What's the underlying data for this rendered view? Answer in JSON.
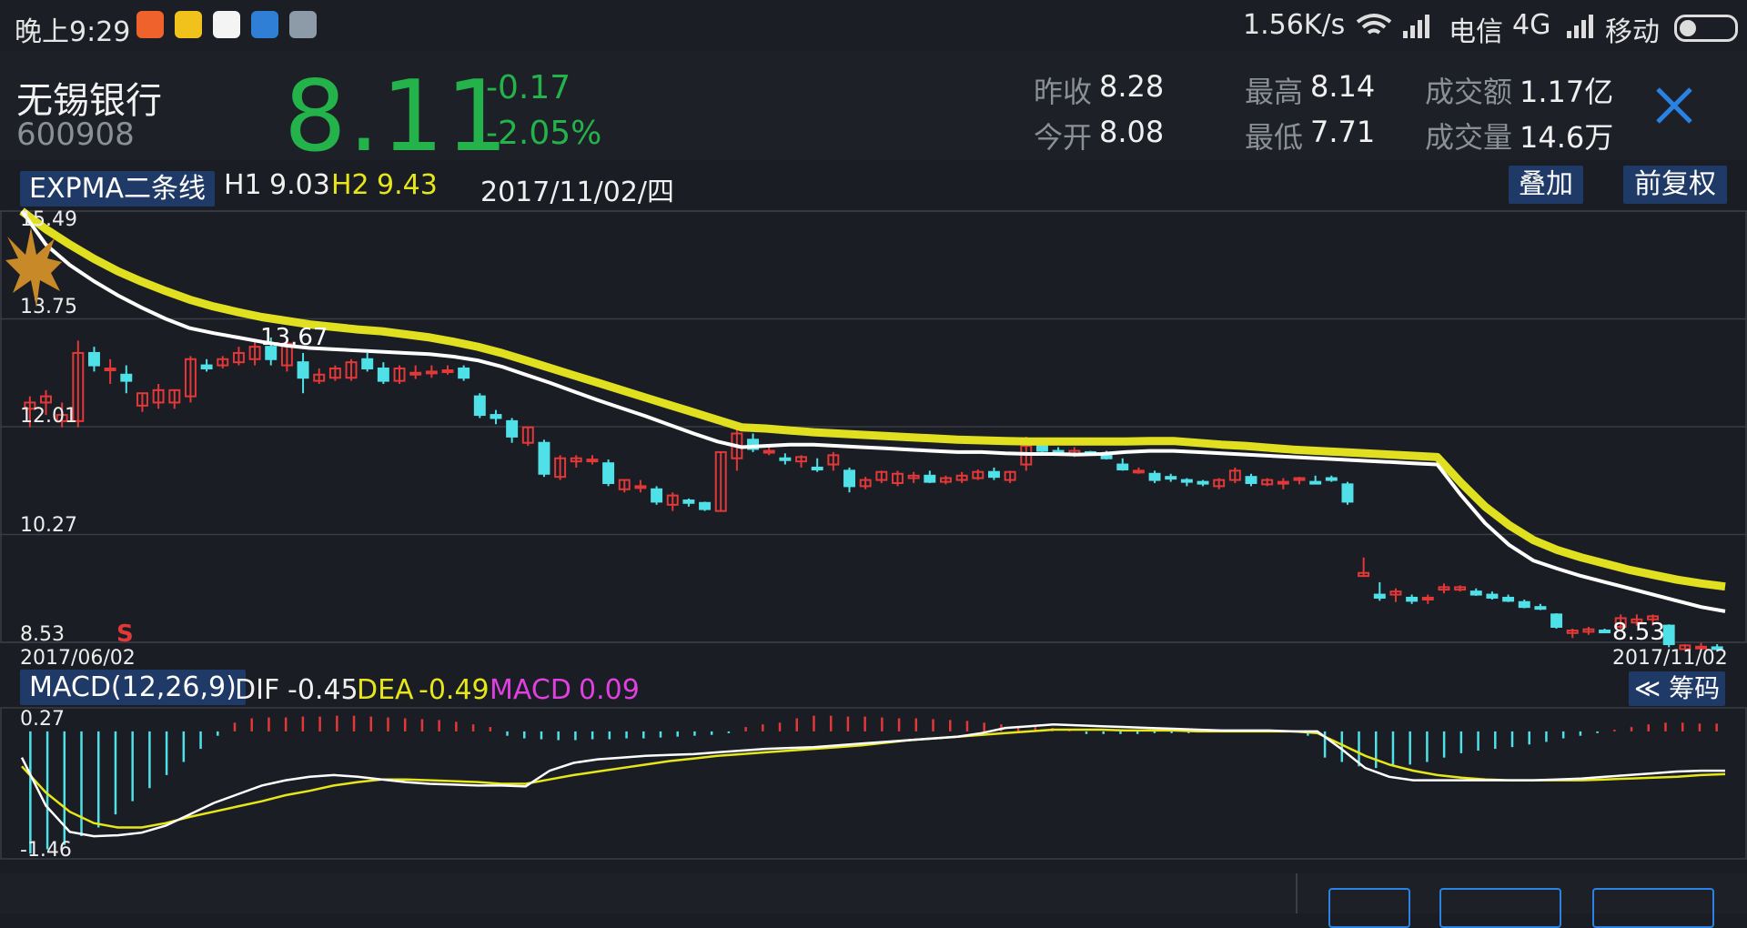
{
  "status_bar": {
    "time": "晚上9:29",
    "speed": "1.56K/s",
    "carrier1": "电信",
    "network": "4G",
    "carrier2": "移动"
  },
  "stock": {
    "name": "无锡银行",
    "code": "600908",
    "price": "8.11",
    "change": "-0.17",
    "change_pct": "-2.05%"
  },
  "stats": {
    "prev_close_label": "昨收",
    "prev_close": "8.28",
    "open_label": "今开",
    "open": "8.08",
    "high_label": "最高",
    "high": "8.14",
    "low_label": "最低",
    "low": "7.71",
    "turnover_label": "成交额",
    "turnover": "1.17亿",
    "volume_label": "成交量",
    "volume": "14.6万"
  },
  "main_chart": {
    "indicator": "EXPMA二条线",
    "h1_label": "H1",
    "h1": "9.03",
    "h2_label": "H2",
    "h2": "9.43",
    "date": "2017/11/02/四",
    "overlay_button": "叠加",
    "adjust_button": "前复权",
    "y_ticks": [
      "15.49",
      "13.75",
      "12.01",
      "10.27",
      "8.53"
    ],
    "start_date": "2017/06/02",
    "end_date": "2017/11/02",
    "high_mark": "13.67",
    "low_mark": "8.53",
    "signal": "S"
  },
  "macd": {
    "title": "MACD(12,26,9)",
    "dif_label": "DIF",
    "dif": "-0.45",
    "dea_label": "DEA",
    "dea": "-0.49",
    "macd_label": "MACD",
    "macd": "0.09",
    "chip_button": "≪ 筹码",
    "y_top": "0.27",
    "y_bottom": "-1.46"
  },
  "colors": {
    "up": "#e23838",
    "down": "#4fe0e8",
    "dif_line": "#ffffff",
    "dea_line": "#e6e61a",
    "expma_slow": "#e0e020",
    "price_green": "#24b24b",
    "button_bg": "#1f3a66"
  },
  "chart_data": [
    {
      "type": "candlestick",
      "title": "EXPMA二条线",
      "x_range": [
        "2017/06/02",
        "2017/11/02"
      ],
      "ylim": [
        8.53,
        15.49
      ],
      "y_ticks": [
        15.49,
        13.75,
        12.01,
        10.27,
        8.53
      ],
      "ohlc": [
        [
          12.3,
          12.5,
          12.0,
          12.4
        ],
        [
          12.4,
          12.6,
          12.2,
          12.5
        ],
        [
          12.1,
          12.4,
          12.0,
          12.2
        ],
        [
          12.1,
          13.4,
          12.0,
          13.2
        ],
        [
          13.2,
          13.3,
          12.9,
          13.0
        ],
        [
          12.95,
          13.1,
          12.7,
          12.95
        ],
        [
          12.85,
          13.0,
          12.55,
          12.75
        ],
        [
          12.35,
          12.55,
          12.25,
          12.55
        ],
        [
          12.4,
          12.7,
          12.3,
          12.6
        ],
        [
          12.4,
          12.6,
          12.3,
          12.6
        ],
        [
          12.5,
          13.15,
          12.4,
          13.1
        ],
        [
          13.0,
          13.1,
          12.9,
          12.95
        ],
        [
          13.0,
          13.15,
          12.95,
          13.1
        ],
        [
          13.05,
          13.3,
          13.0,
          13.2
        ],
        [
          13.1,
          13.4,
          13.0,
          13.3
        ],
        [
          13.3,
          13.45,
          13.0,
          13.1
        ],
        [
          13.0,
          13.4,
          12.9,
          13.35
        ],
        [
          13.05,
          13.2,
          12.55,
          12.8
        ],
        [
          12.75,
          12.95,
          12.7,
          12.85
        ],
        [
          12.8,
          13.0,
          12.75,
          12.95
        ],
        [
          12.8,
          13.1,
          12.75,
          13.05
        ],
        [
          13.1,
          13.2,
          12.9,
          12.95
        ],
        [
          12.95,
          13.05,
          12.7,
          12.75
        ],
        [
          12.75,
          13.0,
          12.7,
          12.95
        ],
        [
          12.88,
          13.0,
          12.78,
          12.88
        ],
        [
          12.9,
          13.0,
          12.8,
          12.9
        ],
        [
          12.92,
          13.0,
          12.85,
          12.92
        ],
        [
          12.95,
          13.0,
          12.75,
          12.8
        ],
        [
          12.5,
          12.55,
          12.15,
          12.2
        ],
        [
          12.2,
          12.28,
          12.05,
          12.15
        ],
        [
          12.1,
          12.15,
          11.75,
          11.85
        ],
        [
          11.75,
          12.0,
          11.7,
          12.0
        ],
        [
          11.75,
          11.8,
          11.2,
          11.25
        ],
        [
          11.2,
          11.55,
          11.15,
          11.5
        ],
        [
          11.45,
          11.55,
          11.35,
          11.5
        ],
        [
          11.48,
          11.55,
          11.4,
          11.48
        ],
        [
          11.42,
          11.48,
          11.05,
          11.1
        ],
        [
          11.0,
          11.15,
          10.95,
          11.15
        ],
        [
          11.05,
          11.15,
          10.95,
          11.05
        ],
        [
          11.0,
          11.05,
          10.75,
          10.8
        ],
        [
          10.75,
          10.95,
          10.65,
          10.9
        ],
        [
          10.82,
          10.85,
          10.72,
          10.78
        ],
        [
          10.78,
          10.8,
          10.65,
          10.68
        ],
        [
          10.65,
          11.6,
          10.65,
          11.6
        ],
        [
          11.5,
          12.0,
          11.3,
          11.9
        ],
        [
          11.8,
          11.9,
          11.6,
          11.65
        ],
        [
          11.62,
          11.72,
          11.55,
          11.62
        ],
        [
          11.5,
          11.58,
          11.4,
          11.48
        ],
        [
          11.45,
          11.55,
          11.35,
          11.52
        ],
        [
          11.35,
          11.5,
          11.28,
          11.32
        ],
        [
          11.4,
          11.6,
          11.3,
          11.55
        ],
        [
          11.3,
          11.35,
          10.95,
          11.05
        ],
        [
          11.05,
          11.2,
          11.0,
          11.15
        ],
        [
          11.15,
          11.3,
          11.1,
          11.28
        ],
        [
          11.1,
          11.3,
          11.05,
          11.25
        ],
        [
          11.18,
          11.28,
          11.1,
          11.22
        ],
        [
          11.22,
          11.3,
          11.1,
          11.12
        ],
        [
          11.12,
          11.22,
          11.08,
          11.18
        ],
        [
          11.15,
          11.28,
          11.1,
          11.22
        ],
        [
          11.18,
          11.32,
          11.15,
          11.28
        ],
        [
          11.28,
          11.35,
          11.15,
          11.2
        ],
        [
          11.15,
          11.3,
          11.1,
          11.28
        ],
        [
          11.4,
          11.85,
          11.3,
          11.7
        ],
        [
          11.72,
          11.78,
          11.6,
          11.62
        ],
        [
          11.62,
          11.68,
          11.55,
          11.6
        ],
        [
          11.55,
          11.68,
          11.52,
          11.62
        ],
        [
          11.6,
          11.62,
          11.55,
          11.58
        ],
        [
          11.58,
          11.62,
          11.48,
          11.5
        ],
        [
          11.4,
          11.5,
          11.3,
          11.32
        ],
        [
          11.3,
          11.35,
          11.25,
          11.3
        ],
        [
          11.25,
          11.3,
          11.1,
          11.15
        ],
        [
          11.2,
          11.25,
          11.12,
          11.18
        ],
        [
          11.15,
          11.18,
          11.05,
          11.12
        ],
        [
          11.12,
          11.15,
          11.05,
          11.1
        ],
        [
          11.05,
          11.18,
          11.0,
          11.15
        ],
        [
          11.15,
          11.35,
          11.1,
          11.3
        ],
        [
          11.2,
          11.25,
          11.05,
          11.1
        ],
        [
          11.08,
          11.18,
          11.05,
          11.15
        ],
        [
          11.1,
          11.18,
          11.0,
          11.12
        ],
        [
          11.15,
          11.2,
          11.08,
          11.18
        ],
        [
          11.12,
          11.22,
          11.08,
          11.1
        ],
        [
          11.18,
          11.22,
          11.12,
          11.15
        ],
        [
          11.08,
          11.12,
          10.75,
          10.8
        ],
        [
          9.6,
          9.9,
          9.6,
          9.65
        ],
        [
          9.3,
          9.5,
          9.2,
          9.25
        ],
        [
          9.3,
          9.4,
          9.18,
          9.35
        ],
        [
          9.25,
          9.3,
          9.15,
          9.2
        ],
        [
          9.22,
          9.3,
          9.15,
          9.25
        ],
        [
          9.38,
          9.48,
          9.32,
          9.42
        ],
        [
          9.38,
          9.45,
          9.35,
          9.42
        ],
        [
          9.35,
          9.4,
          9.28,
          9.3
        ],
        [
          9.3,
          9.35,
          9.22,
          9.25
        ],
        [
          9.25,
          9.3,
          9.18,
          9.2
        ],
        [
          9.18,
          9.22,
          9.08,
          9.1
        ],
        [
          9.1,
          9.15,
          9.05,
          9.08
        ],
        [
          8.98,
          9.0,
          8.75,
          8.78
        ],
        [
          8.68,
          8.75,
          8.6,
          8.72
        ],
        [
          8.7,
          8.78,
          8.65,
          8.74
        ],
        [
          8.72,
          8.75,
          8.68,
          8.7
        ],
        [
          8.78,
          8.98,
          8.75,
          8.92
        ],
        [
          8.85,
          8.98,
          8.8,
          8.9
        ],
        [
          8.9,
          8.98,
          8.8,
          8.95
        ],
        [
          8.8,
          8.82,
          8.45,
          8.5
        ],
        [
          8.42,
          8.5,
          8.4,
          8.48
        ],
        [
          8.45,
          8.52,
          8.4,
          8.46
        ],
        [
          8.45,
          8.5,
          8.4,
          8.42
        ]
      ],
      "series": [
        {
          "name": "H1",
          "values": [
            15.49,
            14.95,
            14.62,
            14.36,
            14.13,
            13.93,
            13.75,
            13.6,
            13.52,
            13.45,
            13.38,
            13.32,
            13.28,
            13.26,
            13.24,
            13.22,
            13.2,
            13.18,
            13.14,
            13.08,
            12.98,
            12.85,
            12.72,
            12.58,
            12.44,
            12.31,
            12.18,
            12.04,
            11.9,
            11.77,
            11.68,
            11.7,
            11.72,
            11.72,
            11.7,
            11.68,
            11.66,
            11.64,
            11.62,
            11.6,
            11.6,
            11.58,
            11.57,
            11.57,
            11.56,
            11.57,
            11.6,
            11.62,
            11.62,
            11.6,
            11.58,
            11.56,
            11.54,
            11.52,
            11.5,
            11.48,
            11.46,
            11.44,
            11.42,
            11.4,
            10.9,
            10.45,
            10.1,
            9.85,
            9.72,
            9.6,
            9.5,
            9.4,
            9.3,
            9.2,
            9.1,
            9.03
          ]
        },
        {
          "name": "H2",
          "values": [
            15.49,
            15.2,
            14.95,
            14.72,
            14.52,
            14.35,
            14.2,
            14.06,
            13.95,
            13.86,
            13.78,
            13.72,
            13.66,
            13.62,
            13.58,
            13.55,
            13.5,
            13.45,
            13.38,
            13.3,
            13.2,
            13.08,
            12.96,
            12.84,
            12.72,
            12.6,
            12.48,
            12.36,
            12.24,
            12.12,
            12.0,
            11.98,
            11.95,
            11.92,
            11.9,
            11.88,
            11.86,
            11.84,
            11.82,
            11.8,
            11.79,
            11.78,
            11.77,
            11.77,
            11.77,
            11.77,
            11.77,
            11.78,
            11.78,
            11.75,
            11.72,
            11.7,
            11.67,
            11.64,
            11.62,
            11.6,
            11.58,
            11.56,
            11.54,
            11.52,
            11.1,
            10.72,
            10.42,
            10.18,
            10.02,
            9.9,
            9.8,
            9.7,
            9.62,
            9.54,
            9.48,
            9.43
          ]
        }
      ]
    },
    {
      "type": "macd",
      "title": "MACD(12,26,9)",
      "ylim": [
        -1.46,
        0.27
      ],
      "series": [
        {
          "name": "DIF",
          "values": [
            -0.3,
            -0.85,
            -1.15,
            -1.2,
            -1.19,
            -1.16,
            -1.08,
            -0.95,
            -0.82,
            -0.72,
            -0.62,
            -0.56,
            -0.52,
            -0.5,
            -0.52,
            -0.55,
            -0.58,
            -0.6,
            -0.61,
            -0.62,
            -0.62,
            -0.63,
            -0.45,
            -0.36,
            -0.32,
            -0.3,
            -0.28,
            -0.27,
            -0.26,
            -0.24,
            -0.22,
            -0.2,
            -0.19,
            -0.18,
            -0.16,
            -0.14,
            -0.12,
            -0.1,
            -0.08,
            -0.06,
            -0.02,
            0.04,
            0.06,
            0.08,
            0.07,
            0.06,
            0.05,
            0.04,
            0.03,
            0.02,
            0.01,
            0.01,
            0.01,
            0.0,
            0.0,
            -0.2,
            -0.42,
            -0.52,
            -0.56,
            -0.56,
            -0.56,
            -0.56,
            -0.56,
            -0.56,
            -0.55,
            -0.54,
            -0.52,
            -0.5,
            -0.48,
            -0.46,
            -0.45,
            -0.45
          ]
        },
        {
          "name": "DEA",
          "values": [
            -0.4,
            -0.7,
            -0.92,
            -1.05,
            -1.1,
            -1.1,
            -1.05,
            -0.98,
            -0.92,
            -0.86,
            -0.8,
            -0.73,
            -0.68,
            -0.62,
            -0.58,
            -0.55,
            -0.55,
            -0.56,
            -0.57,
            -0.58,
            -0.6,
            -0.6,
            -0.55,
            -0.5,
            -0.46,
            -0.42,
            -0.38,
            -0.34,
            -0.31,
            -0.28,
            -0.26,
            -0.24,
            -0.22,
            -0.2,
            -0.18,
            -0.16,
            -0.13,
            -0.1,
            -0.08,
            -0.06,
            -0.04,
            -0.02,
            0.0,
            0.02,
            0.02,
            0.02,
            0.01,
            0.01,
            0.01,
            0.0,
            0.0,
            0.0,
            0.0,
            0.0,
            -0.02,
            -0.15,
            -0.28,
            -0.38,
            -0.45,
            -0.5,
            -0.53,
            -0.55,
            -0.56,
            -0.56,
            -0.56,
            -0.56,
            -0.55,
            -0.54,
            -0.53,
            -0.52,
            -0.5,
            -0.49
          ]
        }
      ],
      "histogram": [
        -1.4,
        -1.35,
        -1.3,
        -1.2,
        -1.1,
        -0.95,
        -0.8,
        -0.65,
        -0.5,
        -0.35,
        -0.2,
        -0.05,
        0.1,
        0.15,
        0.16,
        0.16,
        0.17,
        0.17,
        0.18,
        0.18,
        0.17,
        0.16,
        0.15,
        0.14,
        0.13,
        0.11,
        0.08,
        0.05,
        -0.05,
        -0.08,
        -0.09,
        -0.1,
        -0.1,
        -0.09,
        -0.09,
        -0.08,
        -0.08,
        -0.07,
        -0.06,
        -0.05,
        -0.04,
        -0.02,
        0.05,
        0.08,
        0.1,
        0.15,
        0.18,
        0.18,
        0.17,
        0.17,
        0.16,
        0.15,
        0.15,
        0.14,
        0.13,
        0.12,
        0.1,
        0.08,
        0.06,
        0.05,
        0.04,
        0.02,
        -0.03,
        -0.03,
        -0.03,
        -0.03,
        -0.02,
        -0.02,
        -0.02,
        -0.01,
        -0.01,
        -0.01,
        -0.01,
        -0.01,
        -0.01,
        -0.05,
        -0.3,
        -0.35,
        -0.4,
        -0.42,
        -0.4,
        -0.38,
        -0.35,
        -0.3,
        -0.25,
        -0.22,
        -0.2,
        -0.18,
        -0.15,
        -0.12,
        -0.08,
        -0.05,
        -0.02,
        0.02,
        0.05,
        0.08,
        0.1,
        0.1,
        0.09,
        0.09
      ]
    }
  ]
}
